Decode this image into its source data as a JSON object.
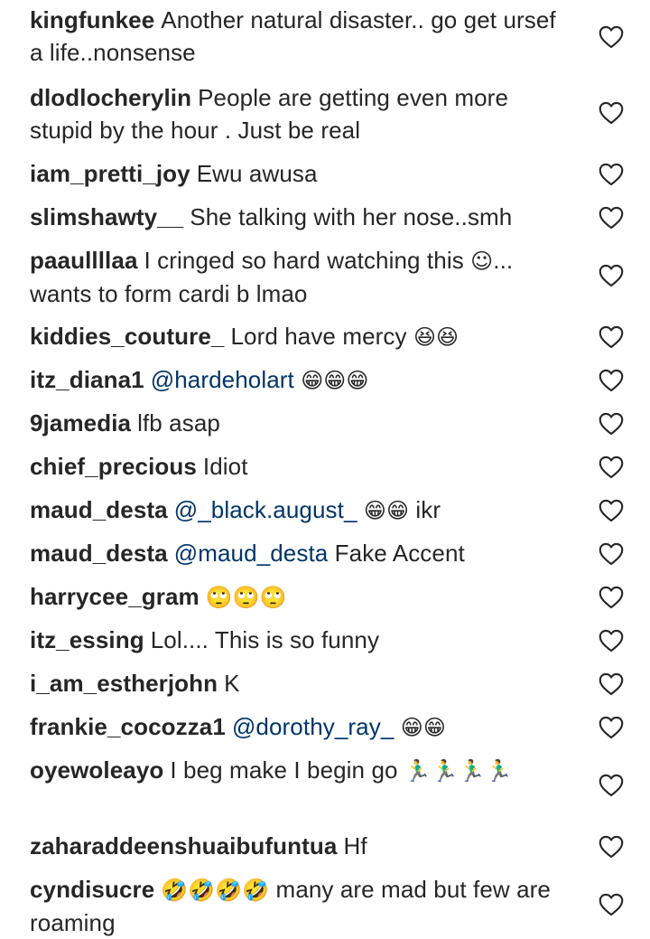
{
  "comments": [
    {
      "username": "kingfunkee",
      "text": "Another natural disaster.. go get ursef a life..nonsense",
      "mention": "",
      "emoji": "",
      "tail": ""
    },
    {
      "username": "dlodlocherylin",
      "text": "People are getting even more stupid by the hour . Just be real",
      "mention": "",
      "emoji": "",
      "tail": ""
    },
    {
      "username": "iam_pretti_joy",
      "text": "Ewu awusa",
      "mention": "",
      "emoji": "",
      "tail": ""
    },
    {
      "username": "slimshawty__",
      "text": "She talking with her nose..smh",
      "mention": "",
      "emoji": "",
      "tail": ""
    },
    {
      "username": "paaullllaa",
      "text": "I cringed so hard watching this",
      "mention": "",
      "emoji": "☺",
      "tail": "... wants to form cardi b lmao"
    },
    {
      "username": "kiddies_couture_",
      "text": "Lord have mercy",
      "mention": "",
      "emoji": "😆😆",
      "tail": ""
    },
    {
      "username": "itz_diana1",
      "text": "",
      "mention": "@hardeholart",
      "emoji": "😁😁😁",
      "tail": ""
    },
    {
      "username": "9jamedia",
      "text": "lfb asap",
      "mention": "",
      "emoji": "",
      "tail": ""
    },
    {
      "username": "chief_precious",
      "text": "Idiot",
      "mention": "",
      "emoji": "",
      "tail": ""
    },
    {
      "username": "maud_desta",
      "text": "",
      "mention": "@_black.august_",
      "emoji": "😁😁",
      "tail": " ikr"
    },
    {
      "username": "maud_desta",
      "text": "",
      "mention": "@maud_desta",
      "emoji": "",
      "tail": " Fake Accent"
    },
    {
      "username": "harrycee_gram",
      "text": "",
      "mention": "",
      "emoji": "🙄🙄🙄",
      "tail": ""
    },
    {
      "username": "itz_essing",
      "text": "Lol.... This is so funny",
      "mention": "",
      "emoji": "",
      "tail": ""
    },
    {
      "username": "i_am_estherjohn",
      "text": "K",
      "mention": "",
      "emoji": "",
      "tail": ""
    },
    {
      "username": "frankie_cocozza1",
      "text": "",
      "mention": "@dorothy_ray_",
      "emoji": "😁😁",
      "tail": ""
    },
    {
      "username": "oyewoleayo",
      "text": "I beg make I begin go",
      "mention": "",
      "emoji": "🏃‍♂🏃‍♂🏃‍♂🏃‍♂",
      "tail": ""
    },
    {
      "username": "zaharaddeenshuaibufuntua",
      "text": "Hf",
      "mention": "",
      "emoji": "",
      "tail": ""
    },
    {
      "username": "cyndisucre",
      "text": "",
      "mention": "",
      "emoji": "🤣🤣🤣🤣",
      "tail": " many are mad but few are roaming"
    }
  ],
  "icons": {
    "like": "heart-outline-icon"
  },
  "colors": {
    "username": "#262626",
    "mention": "#003569",
    "heart": "#262626"
  }
}
